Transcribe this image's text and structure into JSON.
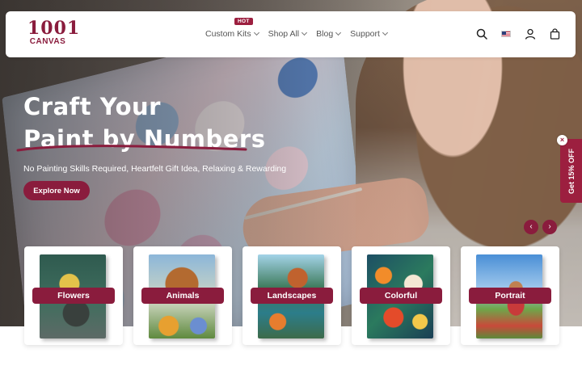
{
  "brand": {
    "logo_top": "1001",
    "logo_bottom": "CANVAS",
    "accent_color": "#8a1c3d"
  },
  "nav": {
    "items": [
      {
        "label": "Custom Kits",
        "badge": "HOT"
      },
      {
        "label": "Shop All"
      },
      {
        "label": "Blog"
      },
      {
        "label": "Support"
      }
    ]
  },
  "header_icons": [
    "search-icon",
    "us-flag-icon",
    "user-icon",
    "cart-icon"
  ],
  "hero": {
    "title_line1": "Craft Your",
    "title_line2": "Paint by Numbers",
    "subtitle": "No Painting Skills Required, Heartfelt Gift Idea, Relaxing & Rewarding",
    "cta_label": "Explore Now"
  },
  "promo_tab": {
    "label": "Get 15% OFF",
    "close_symbol": "×"
  },
  "carousel": {
    "prev_symbol": "‹",
    "next_symbol": "›"
  },
  "categories": [
    {
      "label": "Flowers"
    },
    {
      "label": "Animals"
    },
    {
      "label": "Landscapes"
    },
    {
      "label": "Colorful"
    },
    {
      "label": "Portrait"
    }
  ]
}
